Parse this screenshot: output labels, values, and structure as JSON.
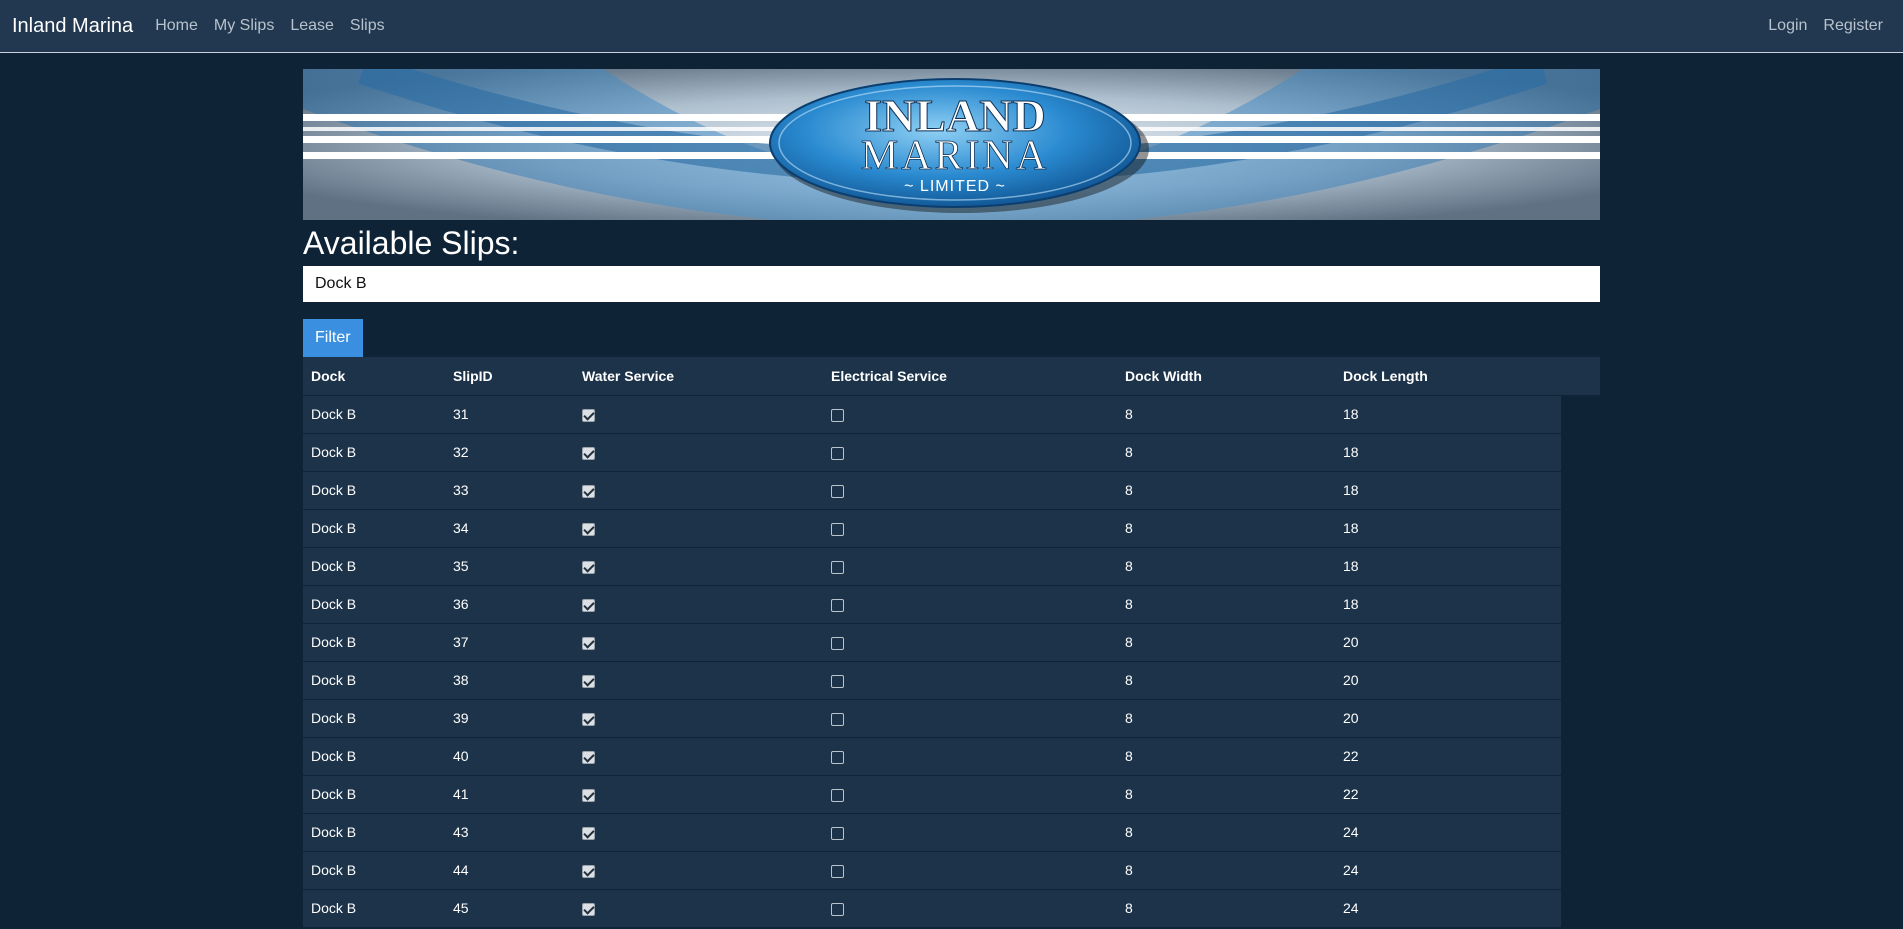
{
  "navbar": {
    "brand": "Inland Marina",
    "links": [
      "Home",
      "My Slips",
      "Lease",
      "Slips"
    ],
    "right_links": [
      "Login",
      "Register"
    ]
  },
  "banner": {
    "logo_line1": "INLAND",
    "logo_line2": "MARINA",
    "logo_line3": "~ LIMITED ~"
  },
  "page": {
    "title": "Available Slips:"
  },
  "filter": {
    "value": "Dock B",
    "button_label": "Filter"
  },
  "table": {
    "headers": [
      "Dock",
      "SlipID",
      "Water Service",
      "Electrical Service",
      "Dock Width",
      "Dock Length"
    ],
    "rows": [
      {
        "dock": "Dock B",
        "slip_id": "31",
        "water": true,
        "electrical": false,
        "width": "8",
        "length": "18"
      },
      {
        "dock": "Dock B",
        "slip_id": "32",
        "water": true,
        "electrical": false,
        "width": "8",
        "length": "18"
      },
      {
        "dock": "Dock B",
        "slip_id": "33",
        "water": true,
        "electrical": false,
        "width": "8",
        "length": "18"
      },
      {
        "dock": "Dock B",
        "slip_id": "34",
        "water": true,
        "electrical": false,
        "width": "8",
        "length": "18"
      },
      {
        "dock": "Dock B",
        "slip_id": "35",
        "water": true,
        "electrical": false,
        "width": "8",
        "length": "18"
      },
      {
        "dock": "Dock B",
        "slip_id": "36",
        "water": true,
        "electrical": false,
        "width": "8",
        "length": "18"
      },
      {
        "dock": "Dock B",
        "slip_id": "37",
        "water": true,
        "electrical": false,
        "width": "8",
        "length": "20"
      },
      {
        "dock": "Dock B",
        "slip_id": "38",
        "water": true,
        "electrical": false,
        "width": "8",
        "length": "20"
      },
      {
        "dock": "Dock B",
        "slip_id": "39",
        "water": true,
        "electrical": false,
        "width": "8",
        "length": "20"
      },
      {
        "dock": "Dock B",
        "slip_id": "40",
        "water": true,
        "electrical": false,
        "width": "8",
        "length": "22"
      },
      {
        "dock": "Dock B",
        "slip_id": "41",
        "water": true,
        "electrical": false,
        "width": "8",
        "length": "22"
      },
      {
        "dock": "Dock B",
        "slip_id": "43",
        "water": true,
        "electrical": false,
        "width": "8",
        "length": "24"
      },
      {
        "dock": "Dock B",
        "slip_id": "44",
        "water": true,
        "electrical": false,
        "width": "8",
        "length": "24"
      },
      {
        "dock": "Dock B",
        "slip_id": "45",
        "water": true,
        "electrical": false,
        "width": "8",
        "length": "24"
      }
    ]
  }
}
